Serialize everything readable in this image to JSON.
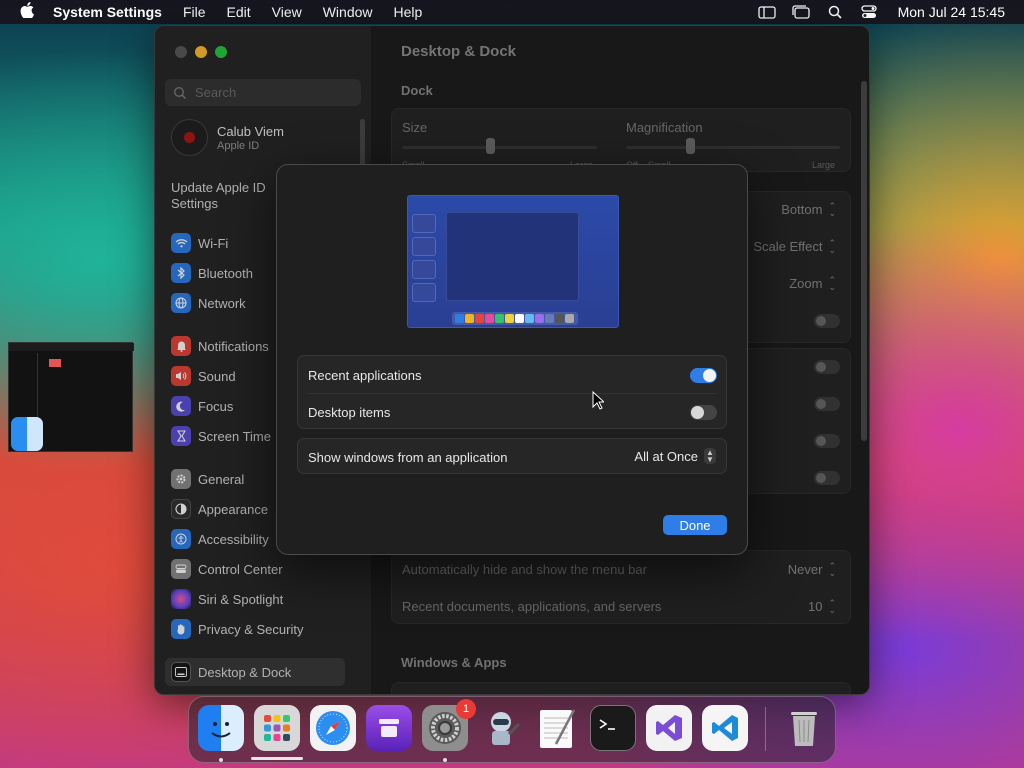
{
  "menubar": {
    "app_name": "System Settings",
    "menus": [
      "File",
      "Edit",
      "View",
      "Window",
      "Help"
    ],
    "clock": "Mon Jul 24  15:45"
  },
  "sidebar": {
    "search_placeholder": "Search",
    "account": {
      "name": "Calub Viem",
      "subtitle": "Apple ID"
    },
    "update_text": "Update Apple ID Settings",
    "items": [
      {
        "label": "Wi-Fi",
        "icon": "wifi-icon",
        "color": "#2f7ee8"
      },
      {
        "label": "Bluetooth",
        "icon": "bluetooth-icon",
        "color": "#2f7ee8"
      },
      {
        "label": "Network",
        "icon": "globe-icon",
        "color": "#2f7ee8"
      },
      {
        "label": "Notifications",
        "icon": "bell-icon",
        "color": "#e5453a"
      },
      {
        "label": "Sound",
        "icon": "speaker-icon",
        "color": "#e5453a"
      },
      {
        "label": "Focus",
        "icon": "moon-icon",
        "color": "#5b4fd6"
      },
      {
        "label": "Screen Time",
        "icon": "hourglass-icon",
        "color": "#5b4fd6"
      },
      {
        "label": "General",
        "icon": "gear-icon",
        "color": "#8a8a8a"
      },
      {
        "label": "Appearance",
        "icon": "appearance-icon",
        "color": "#333333"
      },
      {
        "label": "Accessibility",
        "icon": "accessibility-icon",
        "color": "#2f7ee8"
      },
      {
        "label": "Control Center",
        "icon": "control-center-icon",
        "color": "#8a8a8a"
      },
      {
        "label": "Siri & Spotlight",
        "icon": "siri-icon",
        "color": "#c04bd8"
      },
      {
        "label": "Privacy & Security",
        "icon": "hand-icon",
        "color": "#2f7ee8"
      },
      {
        "label": "Desktop & Dock",
        "icon": "dock-icon",
        "color": "#1a1a1a"
      }
    ]
  },
  "pane": {
    "title": "Desktop & Dock",
    "dock_section": "Dock",
    "size_label": "Size",
    "size_small": "Small",
    "size_large": "Large",
    "size_level": 0.45,
    "magnification_label": "Magnification",
    "mag_off": "Off",
    "mag_small": "Small",
    "mag_large": "Large",
    "mag_level": 0.3,
    "position_value": "Bottom",
    "minimize_value": "Scale Effect",
    "double_click_value": "Zoom",
    "menubar_autohide_label": "Automatically hide and show the menu bar",
    "menubar_autohide_value": "Never",
    "recent_docs_label": "Recent documents, applications, and servers",
    "recent_docs_value": "10",
    "windows_apps_section": "Windows & Apps"
  },
  "sheet": {
    "recent_apps_label": "Recent applications",
    "recent_apps_on": true,
    "desktop_items_label": "Desktop items",
    "desktop_items_on": false,
    "show_windows_label": "Show windows from an application",
    "show_windows_value": "All at Once",
    "done_label": "Done",
    "preview_dock_colors": [
      "#2f7ee8",
      "#f0b428",
      "#e5453a",
      "#e84a9a",
      "#3ac06a",
      "#f0d040",
      "#ffffff",
      "#66b8f0",
      "#9a6ee8",
      "#6a7ab8",
      "#555555",
      "#aaaaaa"
    ]
  },
  "dock": {
    "apps": [
      {
        "name": "Finder",
        "icon": "finder-icon",
        "running": true
      },
      {
        "name": "Launchpad",
        "icon": "launchpad-icon",
        "running": false
      },
      {
        "name": "Safari",
        "icon": "safari-icon",
        "running": false
      },
      {
        "name": "Podcasts Archive",
        "icon": "archive-app-icon",
        "running": false
      },
      {
        "name": "System Settings",
        "icon": "settings-icon",
        "running": true,
        "badge": "1"
      },
      {
        "name": "Automator",
        "icon": "automator-icon",
        "running": false
      },
      {
        "name": "TextEdit",
        "icon": "textedit-icon",
        "running": false
      },
      {
        "name": "Terminal",
        "icon": "terminal-icon",
        "running": false
      },
      {
        "name": "Visual Studio",
        "icon": "visual-studio-icon",
        "running": false
      },
      {
        "name": "VS Code",
        "icon": "vscode-icon",
        "running": false
      },
      {
        "name": "Trash",
        "icon": "trash-icon",
        "running": false
      }
    ]
  }
}
